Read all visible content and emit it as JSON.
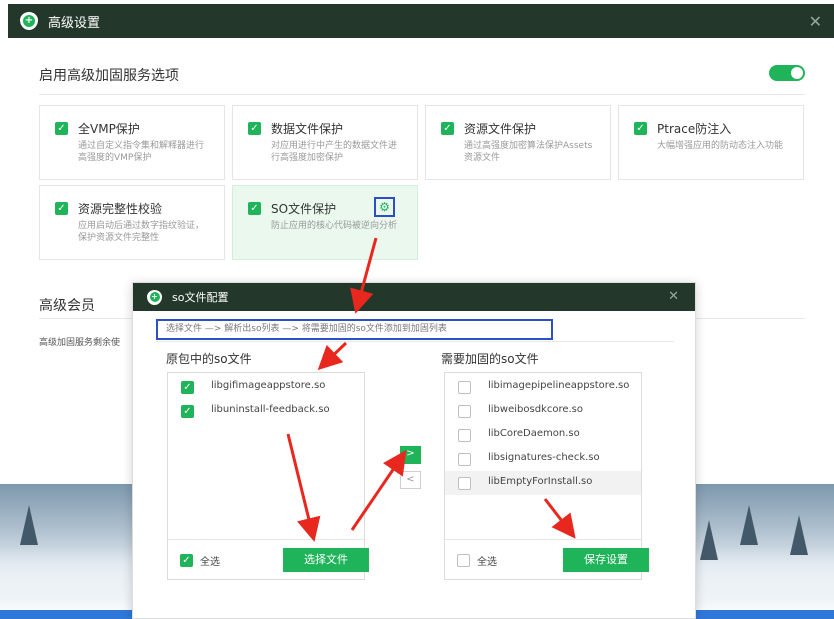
{
  "main_window": {
    "title": "高级设置",
    "close_icon": "close-icon",
    "section_title": "启用高级加固服务选项",
    "toggle_on": true,
    "accent_color": "#1fb35a",
    "titlebar_color": "#23382b",
    "options": [
      {
        "title": "全VMP保护",
        "desc": "通过自定义指令集和解释器进行高强度的VMP保护",
        "checked": true
      },
      {
        "title": "数据文件保护",
        "desc": "对应用进行中产生的数据文件进行高强度加密保护",
        "checked": true
      },
      {
        "title": "资源文件保护",
        "desc": "通过高强度加密算法保护Assets资源文件",
        "checked": true
      },
      {
        "title": "Ptrace防注入",
        "desc": "大幅增强应用的防动态注入功能",
        "checked": true
      },
      {
        "title": "资源完整性校验",
        "desc": "应用启动后通过数字指纹验证，保护资源文件完整性",
        "checked": true
      },
      {
        "title": "SO文件保护",
        "desc": "防止应用的核心代码被逆向分析",
        "checked": true,
        "has_settings": true
      }
    ],
    "member_title": "高级会员",
    "member_text": "高级加固服务剩余使"
  },
  "dialog": {
    "title": "so文件配置",
    "steps": "选择文件 —> 解析出so列表 —> 将需要加固的so文件添加到加固列表",
    "left_panel": {
      "title": "原包中的so文件",
      "files": [
        {
          "name": "libgifimageappstore.so",
          "checked": true
        },
        {
          "name": "libuninstall-feedback.so",
          "checked": true
        }
      ],
      "select_all_label": "全选",
      "select_all_checked": true,
      "button_label": "选择文件"
    },
    "right_panel": {
      "title": "需要加固的so文件",
      "files": [
        {
          "name": "libimagepipelineappstore.so",
          "checked": false
        },
        {
          "name": "libweibosdkcore.so",
          "checked": false
        },
        {
          "name": "libCoreDaemon.so",
          "checked": false
        },
        {
          "name": "libsignatures-check.so",
          "checked": false
        },
        {
          "name": "libEmptyForInstall.so",
          "checked": false
        }
      ],
      "select_all_label": "全选",
      "select_all_checked": false,
      "button_label": "保存设置"
    },
    "move_right_label": ">",
    "move_left_label": "<"
  }
}
